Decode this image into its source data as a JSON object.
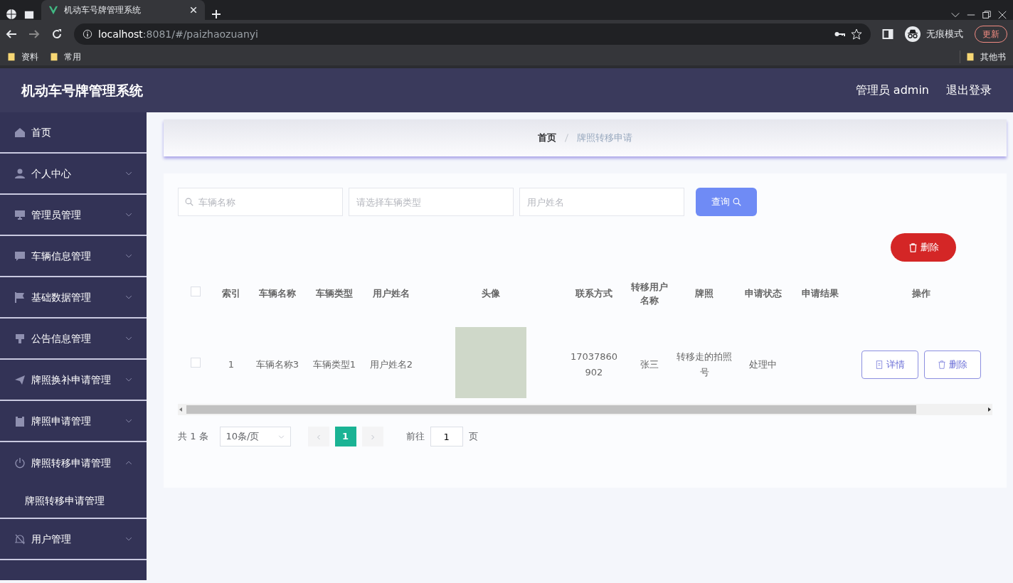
{
  "browser": {
    "tabs": [
      {
        "title": "机动车号牌管理系统",
        "selected": true
      }
    ],
    "url_host": "localhost",
    "url_path": ":8081/#/paizhaozuanyi",
    "profile_label": "无痕模式",
    "update_button": "更新",
    "bookmarks": [
      "资料",
      "常用"
    ],
    "other_bookmarks": "其他书"
  },
  "header": {
    "title": "机动车号牌管理系统",
    "user_label": "管理员 admin",
    "logout": "退出登录"
  },
  "sidebar": {
    "items": [
      {
        "label": "首页"
      },
      {
        "label": "个人中心",
        "expanded": false
      },
      {
        "label": "管理员管理",
        "expanded": false
      },
      {
        "label": "车辆信息管理",
        "expanded": false
      },
      {
        "label": "基础数据管理",
        "expanded": false
      },
      {
        "label": "公告信息管理",
        "expanded": false
      },
      {
        "label": "牌照换补申请管理",
        "expanded": false
      },
      {
        "label": "牌照申请管理",
        "expanded": false
      },
      {
        "label": "牌照转移申请管理",
        "expanded": true,
        "children": [
          {
            "label": "牌照转移申请管理"
          }
        ]
      },
      {
        "label": "用户管理",
        "expanded": false
      }
    ]
  },
  "breadcrumb": [
    "首页",
    "牌照转移申请"
  ],
  "search": {
    "fields": [
      {
        "kind": "input",
        "placeholder": "车辆名称"
      },
      {
        "kind": "select",
        "placeholder": "请选择车辆类型"
      },
      {
        "kind": "input",
        "placeholder": "用户姓名"
      }
    ],
    "button": "查询"
  },
  "delete_button": "删除",
  "table": {
    "all_checked": false,
    "columns": [
      "索引",
      "车辆名称",
      "车辆类型",
      "用户姓名",
      "头像",
      "联系方式",
      "转移用户名称",
      "牌照",
      "申请状态",
      "申请结果",
      "操作"
    ],
    "rows": [
      {
        "checked": false,
        "cells": [
          "1",
          "车辆名称3",
          "车辆类型1",
          "用户姓名2",
          "",
          "17037860902",
          "张三",
          "转移走的拍照号",
          "处理中",
          ""
        ],
        "actions": [
          "详情",
          "删除"
        ]
      }
    ]
  },
  "pagination": {
    "total": "共 1 条",
    "page_size": "10条/页",
    "pages": [
      {
        "label": "1",
        "selected": true
      }
    ],
    "goto_label": "前往",
    "goto_value": "1",
    "goto_suffix": "页"
  }
}
